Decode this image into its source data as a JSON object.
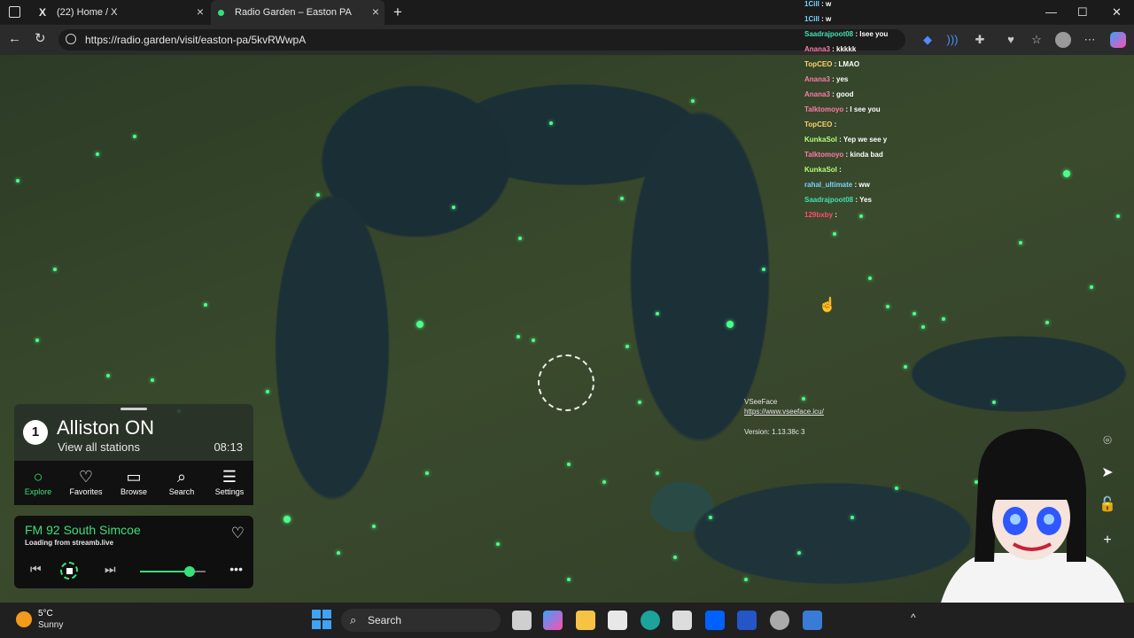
{
  "browser": {
    "tabs": [
      {
        "title": "(22) Home / X",
        "icon": "x-logo-icon"
      },
      {
        "title": "Radio Garden – Easton PA",
        "icon": "radio-garden-dot-icon"
      }
    ],
    "url": "https://radio.garden/visit/easton-pa/5kvRWwpA",
    "colors": {
      "chrome": "#1b1b1b",
      "active_tab": "#2b2b2b"
    }
  },
  "chat": {
    "messages": [
      {
        "user": "1Cill",
        "text": "w",
        "color": "#7ad0ff"
      },
      {
        "user": "1Cill",
        "text": "w",
        "color": "#7ad0ff"
      },
      {
        "user": "Saadrajpoot08",
        "text": "Isee you",
        "color": "#3fe0b0"
      },
      {
        "user": "Anana3",
        "text": "kkkkk",
        "color": "#ff7aa8"
      },
      {
        "user": "TopCEO",
        "text": "LMAO",
        "color": "#ffd36b"
      },
      {
        "user": "Anana3",
        "text": "yes",
        "color": "#ff7aa8"
      },
      {
        "user": "Anana3",
        "text": "good",
        "color": "#ff7aa8"
      },
      {
        "user": "Talktomoyo",
        "text": "I see you",
        "color": "#ff7aa8"
      },
      {
        "user": "TopCEO",
        "text": "",
        "color": "#ffd36b"
      },
      {
        "user": "KunkaSol",
        "text": "Yep we see y",
        "color": "#b6ff7a"
      },
      {
        "user": "Talktomoyo",
        "text": "kinda bad",
        "color": "#ff7aa8"
      },
      {
        "user": "KunkaSol",
        "text": "",
        "color": "#b6ff7a"
      },
      {
        "user": "rahal_ultimate",
        "text": "ww",
        "color": "#7ad0ff"
      },
      {
        "user": "Saadrajpoot08",
        "text": "Yes",
        "color": "#3fe0b0"
      },
      {
        "user": "129bxby",
        "text": "",
        "color": "#ff4d6d"
      }
    ]
  },
  "overlay": {
    "vseeface_title": "VSeeFace",
    "vseeface_url": "https://www.vseeface.icu/",
    "vseeface_version": "Version: 1.13.38c 3"
  },
  "radio_garden": {
    "station_count": "1",
    "place": "Alliston ON",
    "view_all": "View all stations",
    "local_time": "08:13",
    "nav": [
      {
        "label": "Explore",
        "icon": "explore-circle-icon"
      },
      {
        "label": "Favorites",
        "icon": "heart-icon"
      },
      {
        "label": "Browse",
        "icon": "map-icon"
      },
      {
        "label": "Search",
        "icon": "search-icon"
      },
      {
        "label": "Settings",
        "icon": "menu-icon"
      }
    ],
    "player": {
      "station": "FM 92 South Simcoe",
      "status": "Loading from streamb.live",
      "volume": 0.75
    },
    "accent": "#38e07a"
  },
  "taskbar": {
    "weather_temp": "5°C",
    "weather_cond": "Sunny",
    "search_label": "Search"
  }
}
